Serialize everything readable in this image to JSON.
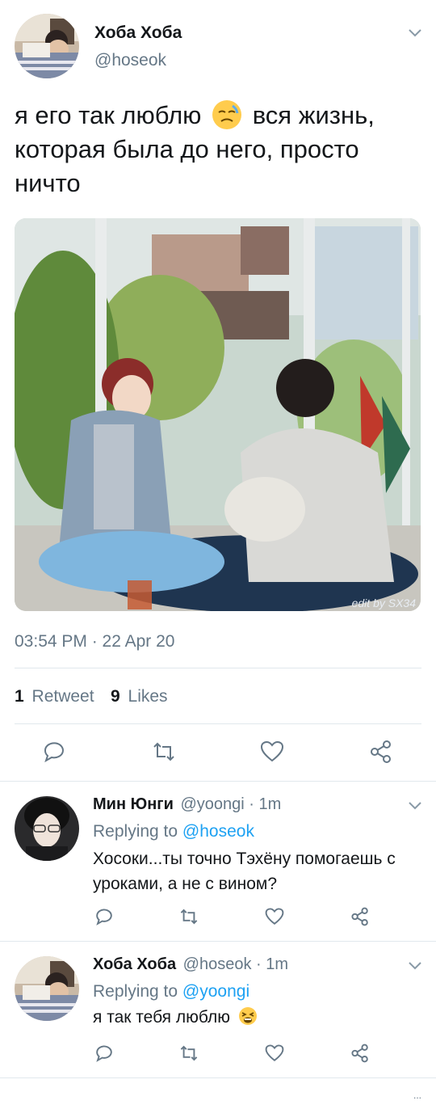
{
  "tweet": {
    "author_name": "Хоба Хоба",
    "author_handle": "@hoseok",
    "text_part1": "я его так люблю",
    "text_part2": "вся жизнь,",
    "text_line2": "которая была до него, просто",
    "text_line3": "ничто",
    "image_watermark": "edit by SX34",
    "timestamp": "03:54 PM · 22 Apr 20",
    "retweet_count": "1",
    "retweet_label": "Retweet",
    "like_count": "9",
    "like_label": "Likes"
  },
  "replies": [
    {
      "author_name": "Мин Юнги",
      "author_handle": "@yoongi",
      "time": "· 1m",
      "replying_prefix": "Replying to",
      "replying_to": "@hoseok",
      "text_line1": "Хосоки...ты точно Тэхёну помогаешь с",
      "text_line2": "уроками, а не с вином?"
    },
    {
      "author_name": "Хоба Хоба",
      "author_handle": "@hoseok",
      "time": "· 1m",
      "replying_prefix": "Replying to",
      "replying_to": "@yoongi",
      "text_line1": "я так тебя люблю"
    }
  ],
  "footer_glyph": "...",
  "colors": {
    "accent": "#1da1f2",
    "secondary_text": "#657786",
    "divider": "#e1e8ed"
  },
  "icons": [
    "chevron-down-icon",
    "reply-icon",
    "retweet-icon",
    "like-icon",
    "share-icon",
    "emoji-downcast-icon",
    "emoji-tired-icon"
  ]
}
